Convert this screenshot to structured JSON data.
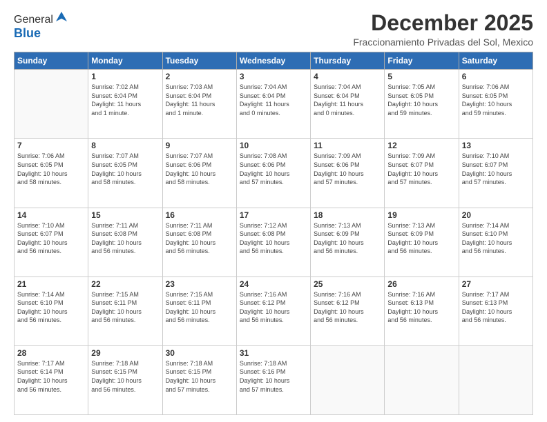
{
  "header": {
    "logo_general": "General",
    "logo_blue": "Blue",
    "month_title": "December 2025",
    "subtitle": "Fraccionamiento Privadas del Sol, Mexico"
  },
  "days_of_week": [
    "Sunday",
    "Monday",
    "Tuesday",
    "Wednesday",
    "Thursday",
    "Friday",
    "Saturday"
  ],
  "weeks": [
    [
      {
        "day": "",
        "info": ""
      },
      {
        "day": "1",
        "info": "Sunrise: 7:02 AM\nSunset: 6:04 PM\nDaylight: 11 hours\nand 1 minute."
      },
      {
        "day": "2",
        "info": "Sunrise: 7:03 AM\nSunset: 6:04 PM\nDaylight: 11 hours\nand 1 minute."
      },
      {
        "day": "3",
        "info": "Sunrise: 7:04 AM\nSunset: 6:04 PM\nDaylight: 11 hours\nand 0 minutes."
      },
      {
        "day": "4",
        "info": "Sunrise: 7:04 AM\nSunset: 6:04 PM\nDaylight: 11 hours\nand 0 minutes."
      },
      {
        "day": "5",
        "info": "Sunrise: 7:05 AM\nSunset: 6:05 PM\nDaylight: 10 hours\nand 59 minutes."
      },
      {
        "day": "6",
        "info": "Sunrise: 7:06 AM\nSunset: 6:05 PM\nDaylight: 10 hours\nand 59 minutes."
      }
    ],
    [
      {
        "day": "7",
        "info": "Sunrise: 7:06 AM\nSunset: 6:05 PM\nDaylight: 10 hours\nand 58 minutes."
      },
      {
        "day": "8",
        "info": "Sunrise: 7:07 AM\nSunset: 6:05 PM\nDaylight: 10 hours\nand 58 minutes."
      },
      {
        "day": "9",
        "info": "Sunrise: 7:07 AM\nSunset: 6:06 PM\nDaylight: 10 hours\nand 58 minutes."
      },
      {
        "day": "10",
        "info": "Sunrise: 7:08 AM\nSunset: 6:06 PM\nDaylight: 10 hours\nand 57 minutes."
      },
      {
        "day": "11",
        "info": "Sunrise: 7:09 AM\nSunset: 6:06 PM\nDaylight: 10 hours\nand 57 minutes."
      },
      {
        "day": "12",
        "info": "Sunrise: 7:09 AM\nSunset: 6:07 PM\nDaylight: 10 hours\nand 57 minutes."
      },
      {
        "day": "13",
        "info": "Sunrise: 7:10 AM\nSunset: 6:07 PM\nDaylight: 10 hours\nand 57 minutes."
      }
    ],
    [
      {
        "day": "14",
        "info": "Sunrise: 7:10 AM\nSunset: 6:07 PM\nDaylight: 10 hours\nand 56 minutes."
      },
      {
        "day": "15",
        "info": "Sunrise: 7:11 AM\nSunset: 6:08 PM\nDaylight: 10 hours\nand 56 minutes."
      },
      {
        "day": "16",
        "info": "Sunrise: 7:11 AM\nSunset: 6:08 PM\nDaylight: 10 hours\nand 56 minutes."
      },
      {
        "day": "17",
        "info": "Sunrise: 7:12 AM\nSunset: 6:08 PM\nDaylight: 10 hours\nand 56 minutes."
      },
      {
        "day": "18",
        "info": "Sunrise: 7:13 AM\nSunset: 6:09 PM\nDaylight: 10 hours\nand 56 minutes."
      },
      {
        "day": "19",
        "info": "Sunrise: 7:13 AM\nSunset: 6:09 PM\nDaylight: 10 hours\nand 56 minutes."
      },
      {
        "day": "20",
        "info": "Sunrise: 7:14 AM\nSunset: 6:10 PM\nDaylight: 10 hours\nand 56 minutes."
      }
    ],
    [
      {
        "day": "21",
        "info": "Sunrise: 7:14 AM\nSunset: 6:10 PM\nDaylight: 10 hours\nand 56 minutes."
      },
      {
        "day": "22",
        "info": "Sunrise: 7:15 AM\nSunset: 6:11 PM\nDaylight: 10 hours\nand 56 minutes."
      },
      {
        "day": "23",
        "info": "Sunrise: 7:15 AM\nSunset: 6:11 PM\nDaylight: 10 hours\nand 56 minutes."
      },
      {
        "day": "24",
        "info": "Sunrise: 7:16 AM\nSunset: 6:12 PM\nDaylight: 10 hours\nand 56 minutes."
      },
      {
        "day": "25",
        "info": "Sunrise: 7:16 AM\nSunset: 6:12 PM\nDaylight: 10 hours\nand 56 minutes."
      },
      {
        "day": "26",
        "info": "Sunrise: 7:16 AM\nSunset: 6:13 PM\nDaylight: 10 hours\nand 56 minutes."
      },
      {
        "day": "27",
        "info": "Sunrise: 7:17 AM\nSunset: 6:13 PM\nDaylight: 10 hours\nand 56 minutes."
      }
    ],
    [
      {
        "day": "28",
        "info": "Sunrise: 7:17 AM\nSunset: 6:14 PM\nDaylight: 10 hours\nand 56 minutes."
      },
      {
        "day": "29",
        "info": "Sunrise: 7:18 AM\nSunset: 6:15 PM\nDaylight: 10 hours\nand 56 minutes."
      },
      {
        "day": "30",
        "info": "Sunrise: 7:18 AM\nSunset: 6:15 PM\nDaylight: 10 hours\nand 57 minutes."
      },
      {
        "day": "31",
        "info": "Sunrise: 7:18 AM\nSunset: 6:16 PM\nDaylight: 10 hours\nand 57 minutes."
      },
      {
        "day": "",
        "info": ""
      },
      {
        "day": "",
        "info": ""
      },
      {
        "day": "",
        "info": ""
      }
    ]
  ]
}
